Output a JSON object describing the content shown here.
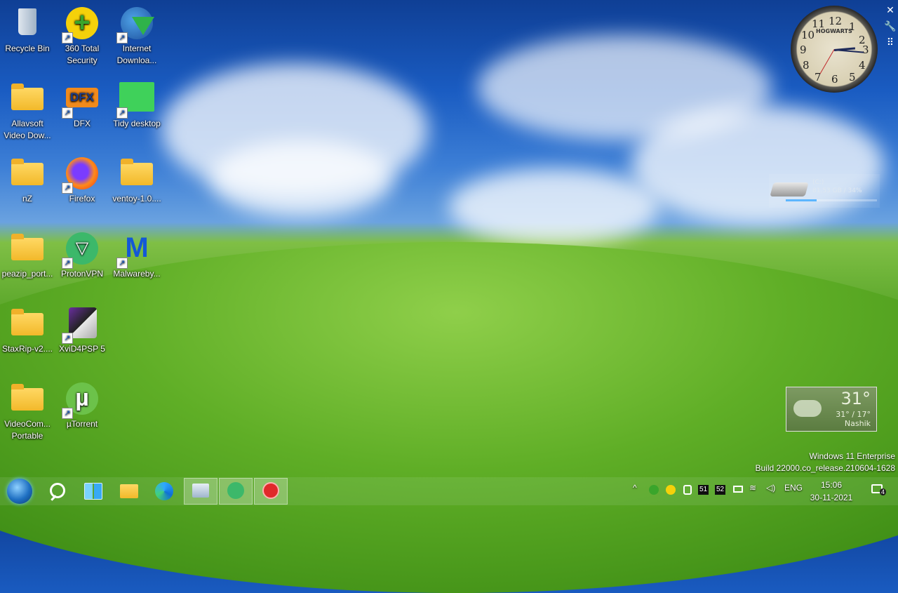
{
  "desktop_icons": [
    {
      "label": "Recycle Bin",
      "icon": "recycle-bin-icon"
    },
    {
      "label": "360 Total Security",
      "icon": "security-plus-icon"
    },
    {
      "label": "Internet Downloa...",
      "icon": "download-globe-icon"
    },
    {
      "label": "Allavsoft Video Dow...",
      "icon": "folder-icon"
    },
    {
      "label": "DFX",
      "icon": "dfx-icon"
    },
    {
      "label": "Tidy desktop",
      "icon": "tidy-desktop-icon"
    },
    {
      "label": "nZ",
      "icon": "folder-icon"
    },
    {
      "label": "Firefox",
      "icon": "firefox-icon"
    },
    {
      "label": "ventoy-1.0....",
      "icon": "folder-icon"
    },
    {
      "label": "peazip_port...",
      "icon": "folder-icon"
    },
    {
      "label": "ProtonVPN",
      "icon": "vpn-icon"
    },
    {
      "label": "Malwareby...",
      "icon": "malwarebytes-icon"
    },
    {
      "label": "StaxRip-v2....",
      "icon": "folder-icon"
    },
    {
      "label": "XviD4PSP 5",
      "icon": "film-reel-icon"
    },
    {
      "label": "VideoCom... Portable",
      "icon": "folder-icon"
    },
    {
      "label": "µTorrent",
      "icon": "utorrent-icon"
    }
  ],
  "clock_widget": {
    "brand": "HOGWARTS",
    "numbers": [
      "12",
      "1",
      "2",
      "3",
      "4",
      "5",
      "6",
      "7",
      "8",
      "9",
      "10",
      "11"
    ]
  },
  "widget_controls": {
    "close": "✕",
    "settings": "🔧",
    "grip": "⠿"
  },
  "drive_widget": {
    "drive": "(C:)",
    "usage": "81.53 GB / 34%",
    "fill_percent": 34
  },
  "weather_widget": {
    "temp": "31°",
    "range": "31° / 17°",
    "city": "Nashik"
  },
  "watermark": {
    "line1": "Windows 11 Enterprise",
    "line2": "Build 22000.co_release.210604-1628"
  },
  "taskbar": {
    "tray": {
      "chevron": "^",
      "temp1": "51",
      "temp2": "52",
      "language": "ENG",
      "time": "15:06",
      "date": "30-11-2021",
      "notifications": "4"
    }
  }
}
